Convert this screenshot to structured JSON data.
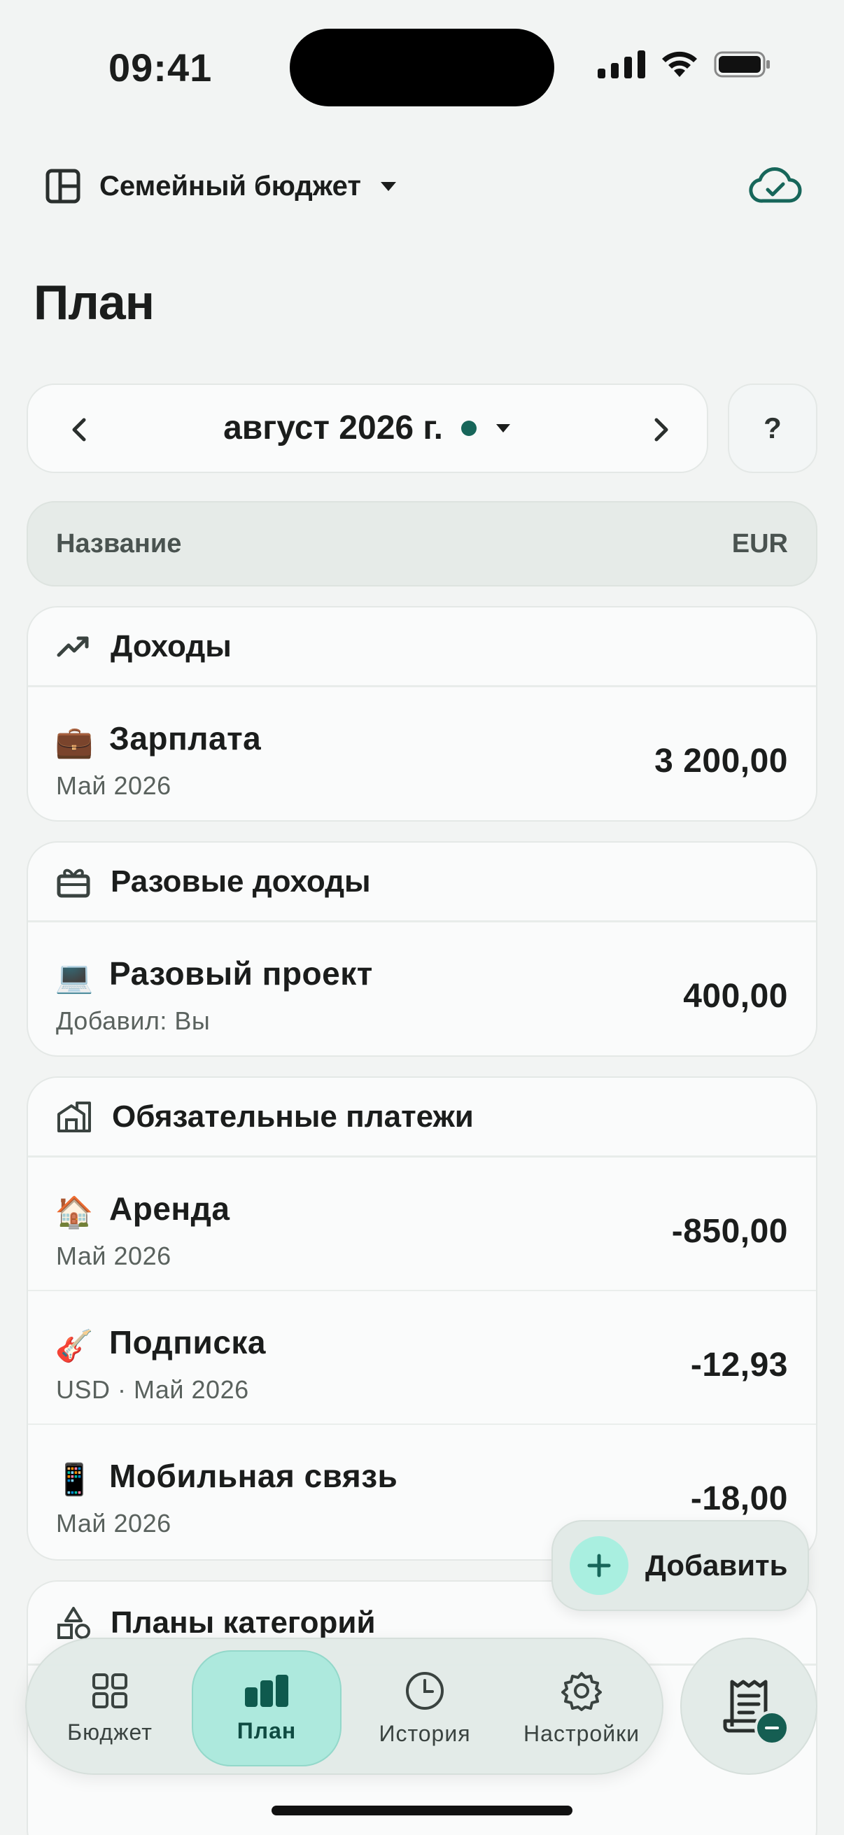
{
  "status_bar": {
    "time": "09:41"
  },
  "header": {
    "budget_name": "Семейный бюджет"
  },
  "page_title": "План",
  "month_nav": {
    "month_label": "август 2026 г.",
    "help_label": "?"
  },
  "table_header": {
    "name_col": "Название",
    "currency_col": "EUR"
  },
  "sections": {
    "income": {
      "title": "Доходы",
      "rows": [
        {
          "emoji": "💼",
          "title": "Зарплата",
          "subtitle": "Май 2026",
          "amount": "3 200,00"
        }
      ]
    },
    "one_time": {
      "title": "Разовые доходы",
      "rows": [
        {
          "emoji": "💻",
          "title": "Разовый проект",
          "subtitle": "Добавил: Вы",
          "amount": "400,00"
        }
      ]
    },
    "mandatory": {
      "title": "Обязательные платежи",
      "rows": [
        {
          "emoji": "🏠",
          "title": "Аренда",
          "subtitle": "Май 2026",
          "amount": "-850,00"
        },
        {
          "emoji": "🎸",
          "title": "Подписка",
          "subtitle": "USD · Май 2026",
          "amount": "-12,93"
        },
        {
          "emoji": "📱",
          "title": "Мобильная связь",
          "subtitle": "Май 2026",
          "amount": "-18,00"
        }
      ]
    },
    "category_plans": {
      "title": "Планы категорий"
    }
  },
  "fab": {
    "label": "Добавить"
  },
  "tabbar": {
    "tabs": [
      {
        "label": "Бюджет"
      },
      {
        "label": "План"
      },
      {
        "label": "История"
      },
      {
        "label": "Настройки"
      }
    ]
  },
  "colors": {
    "accent": "#17665a",
    "active_tab": "#ade9dd",
    "background": "#f2f4f3"
  }
}
